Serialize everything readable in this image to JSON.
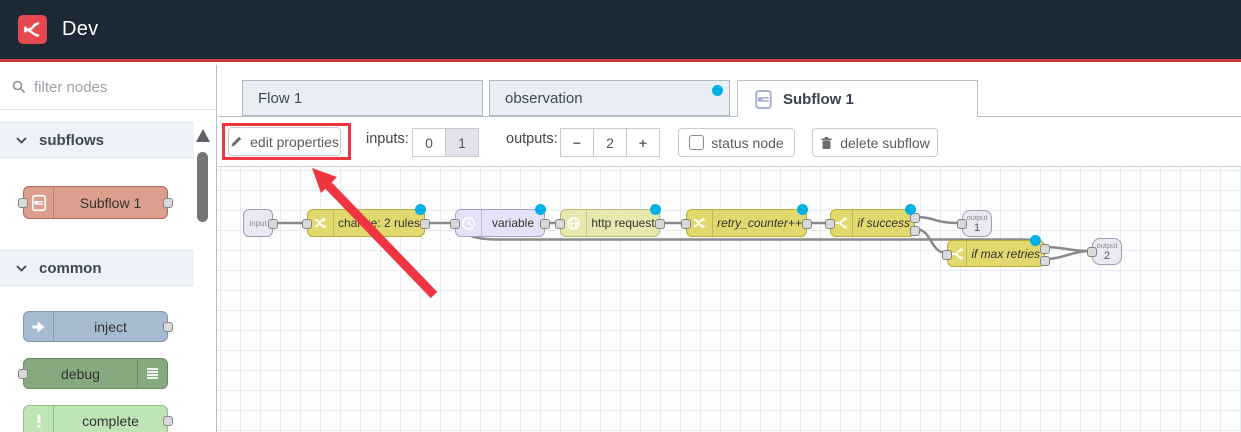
{
  "colors": {
    "header_bg": "#1e2936",
    "logo_red": "#e5494f",
    "header_line": "#c9363d",
    "changed_dot": "#00b1e5",
    "accent_red": "#ee3540"
  },
  "header": {
    "title": "Dev"
  },
  "sidebar": {
    "search_placeholder": "filter nodes",
    "sections": [
      {
        "label": "subflows",
        "nodes": [
          {
            "label": "Subflow 1",
            "type": "subflow"
          }
        ]
      },
      {
        "label": "common",
        "nodes": [
          {
            "label": "inject",
            "type": "inject"
          },
          {
            "label": "debug",
            "type": "debug"
          },
          {
            "label": "complete",
            "type": "complete"
          }
        ]
      }
    ]
  },
  "tabs": [
    {
      "label": "Flow 1",
      "active": false,
      "changed": false
    },
    {
      "label": "observation",
      "active": false,
      "changed": true
    },
    {
      "label": "Subflow 1",
      "active": true,
      "changed": false
    }
  ],
  "toolbar": {
    "edit_properties_label": "edit properties",
    "inputs_label": "inputs:",
    "input_options": [
      "0",
      "1"
    ],
    "selected_inputs": "1",
    "outputs_label": "outputs:",
    "minus_label": "−",
    "outputs_value": "2",
    "plus_label": "+",
    "status_node_label": "status node",
    "delete_subflow_label": "delete subflow"
  },
  "canvas": {
    "nodes": [
      {
        "label": "input",
        "type": "subflow-input"
      },
      {
        "label": "change: 2 rules",
        "type": "change",
        "changed": true
      },
      {
        "label": "variable",
        "type": "delay",
        "changed": true
      },
      {
        "label": "http request",
        "type": "http-request",
        "changed": true
      },
      {
        "label": "retry_counter++",
        "type": "change",
        "changed": true
      },
      {
        "label": "if success",
        "type": "switch",
        "outputs": 2,
        "changed": true
      },
      {
        "label": "if max retries",
        "type": "switch",
        "outputs": 2,
        "changed": true
      },
      {
        "label": "output",
        "number": "1",
        "type": "subflow-output"
      },
      {
        "label": "output",
        "number": "2",
        "type": "subflow-output"
      }
    ]
  }
}
